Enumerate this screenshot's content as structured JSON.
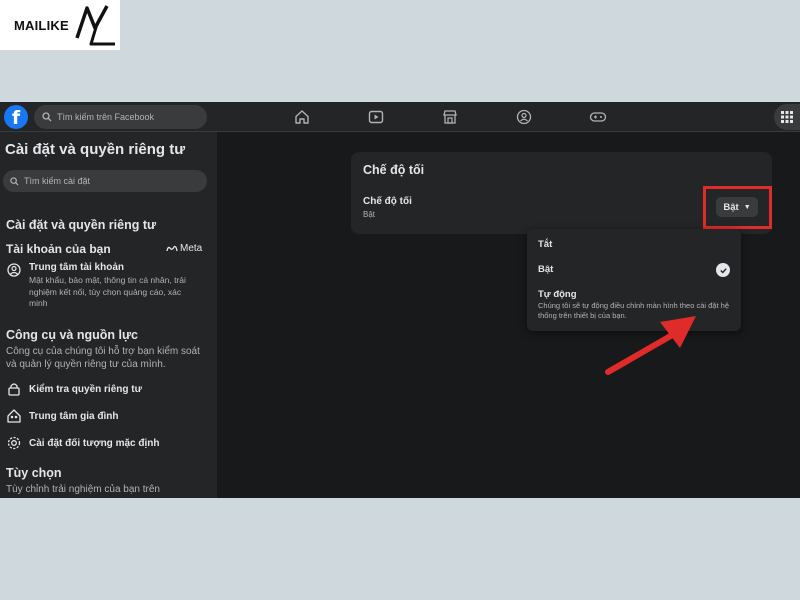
{
  "watermark": {
    "text": "MAILIKE",
    "mark": "ML"
  },
  "topbar": {
    "search_placeholder": "Tìm kiếm trên Facebook",
    "nav_icons": [
      "home-icon",
      "video-icon",
      "marketplace-icon",
      "groups-icon",
      "gaming-icon",
      "menu-grid-icon"
    ]
  },
  "sidebar": {
    "title": "Cài đặt và quyền riêng tư",
    "search_placeholder": "Tìm kiếm cài đặt",
    "section_title": "Cài đặt và quyền riêng tư",
    "account": {
      "title": "Tài khoản của bạn",
      "brand": "Meta",
      "center_title": "Trung tâm tài khoản",
      "center_desc": "Mật khẩu, bảo mật, thông tin cá nhân, trải nghiệm kết nối, tùy chọn quảng cáo, xác minh"
    },
    "tools": {
      "title": "Công cụ và nguồn lực",
      "desc": "Công cụ của chúng tôi hỗ trợ bạn kiểm soát và quản lý quyền riêng tư của mình.",
      "items": [
        "Kiểm tra quyền riêng tư",
        "Trung tâm gia đình",
        "Cài đặt đối tượng mặc định"
      ]
    },
    "preferences": {
      "title": "Tùy chọn",
      "desc": "Tùy chỉnh trải nghiệm của bạn trên"
    }
  },
  "main": {
    "card_title": "Chế độ tối",
    "row_label": "Chế độ tối",
    "row_value": "Bật",
    "button_label": "Bật"
  },
  "menu": {
    "options": [
      "Tắt",
      "Bật",
      "Tự động"
    ],
    "auto_desc": "Chúng tôi sẽ tự động điều chỉnh màn hình theo cài đặt hệ thống trên thiết bị của bạn.",
    "selected": "Bật"
  },
  "colors": {
    "facebook_blue": "#1877f2",
    "dark_bg": "#18191a",
    "panel": "#242526",
    "highlight": "#e02b2b"
  }
}
